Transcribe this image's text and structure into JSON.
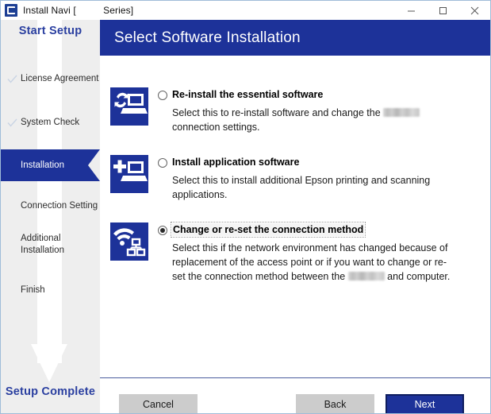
{
  "window": {
    "title": "Install Navi [          Series]",
    "app_icon": "epson-installer-icon",
    "controls": {
      "minimize": "minimize-icon",
      "maximize": "maximize-icon",
      "close": "close-icon"
    }
  },
  "sidebar": {
    "title": "Start Setup",
    "footer": "Setup Complete",
    "items": [
      {
        "label": "License Agreement",
        "state": "completed"
      },
      {
        "label": "System Check",
        "state": "completed"
      },
      {
        "label": "Installation",
        "state": "active"
      },
      {
        "label": "Connection Setting",
        "state": "pending"
      },
      {
        "label": "Additional\nInstallation",
        "state": "pending"
      },
      {
        "label": "Finish",
        "state": "pending"
      }
    ]
  },
  "main": {
    "header": "Select Software Installation",
    "options": [
      {
        "icon": "reinstall-computer-icon",
        "title": "Re-install the essential software",
        "desc_before": "Select this to re-install software and change the ",
        "desc_after": " connection settings.",
        "has_redaction": true,
        "selected": false,
        "focused": false
      },
      {
        "icon": "add-application-computer-icon",
        "title": "Install application software",
        "desc_before": "Select this to install additional Epson printing and scanning applications.",
        "desc_after": "",
        "has_redaction": false,
        "selected": false,
        "focused": false
      },
      {
        "icon": "wifi-network-icon",
        "title": "Change or re-set the connection method",
        "desc_before": "Select this if the network environment has changed because of replacement of the access point or if you want to change or re-set the connection method between the ",
        "desc_after": " and computer.",
        "has_redaction": true,
        "selected": true,
        "focused": true
      }
    ]
  },
  "footer": {
    "cancel_label": "Cancel",
    "back_label": "Back",
    "next_label": "Next"
  },
  "colors": {
    "brand_navy": "#1d3299",
    "sidebar_bg": "#eeeeee",
    "button_gray": "#cccccc",
    "title_blue": "#2a3fa0"
  }
}
